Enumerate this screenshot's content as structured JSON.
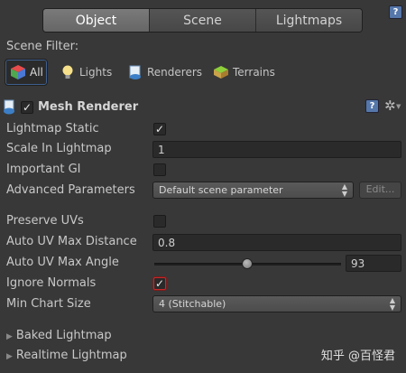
{
  "tabs": [
    "Object",
    "Scene",
    "Lightmaps"
  ],
  "scene_filter": {
    "label": "Scene Filter:",
    "buttons": [
      "All",
      "Lights",
      "Renderers",
      "Terrains"
    ]
  },
  "component": {
    "title": "Mesh Renderer"
  },
  "fields": {
    "lightmap_static": "Lightmap Static",
    "scale_in_lightmap": "Scale In Lightmap",
    "scale_value": "1",
    "important_gi": "Important GI",
    "advanced_parameters": "Advanced Parameters",
    "advanced_value": "Default scene parameter",
    "edit_label": "Edit...",
    "preserve_uvs": "Preserve UVs",
    "auto_uv_max_distance": "Auto UV Max Distance",
    "distance_value": "0.8",
    "auto_uv_max_angle": "Auto UV Max Angle",
    "angle_value": "93",
    "ignore_normals": "Ignore Normals",
    "min_chart_size": "Min Chart Size",
    "min_chart_value": "4 (Stitchable)"
  },
  "checkboxes": {
    "lightmap_static": true,
    "important_gi": false,
    "preserve_uvs": false,
    "ignore_normals": true
  },
  "sections": {
    "baked": "Baked Lightmap",
    "realtime": "Realtime Lightmap"
  },
  "watermark": "知乎 @百怪君",
  "colors": {
    "background": "#383838",
    "accent_outline": "#c42a2a"
  }
}
